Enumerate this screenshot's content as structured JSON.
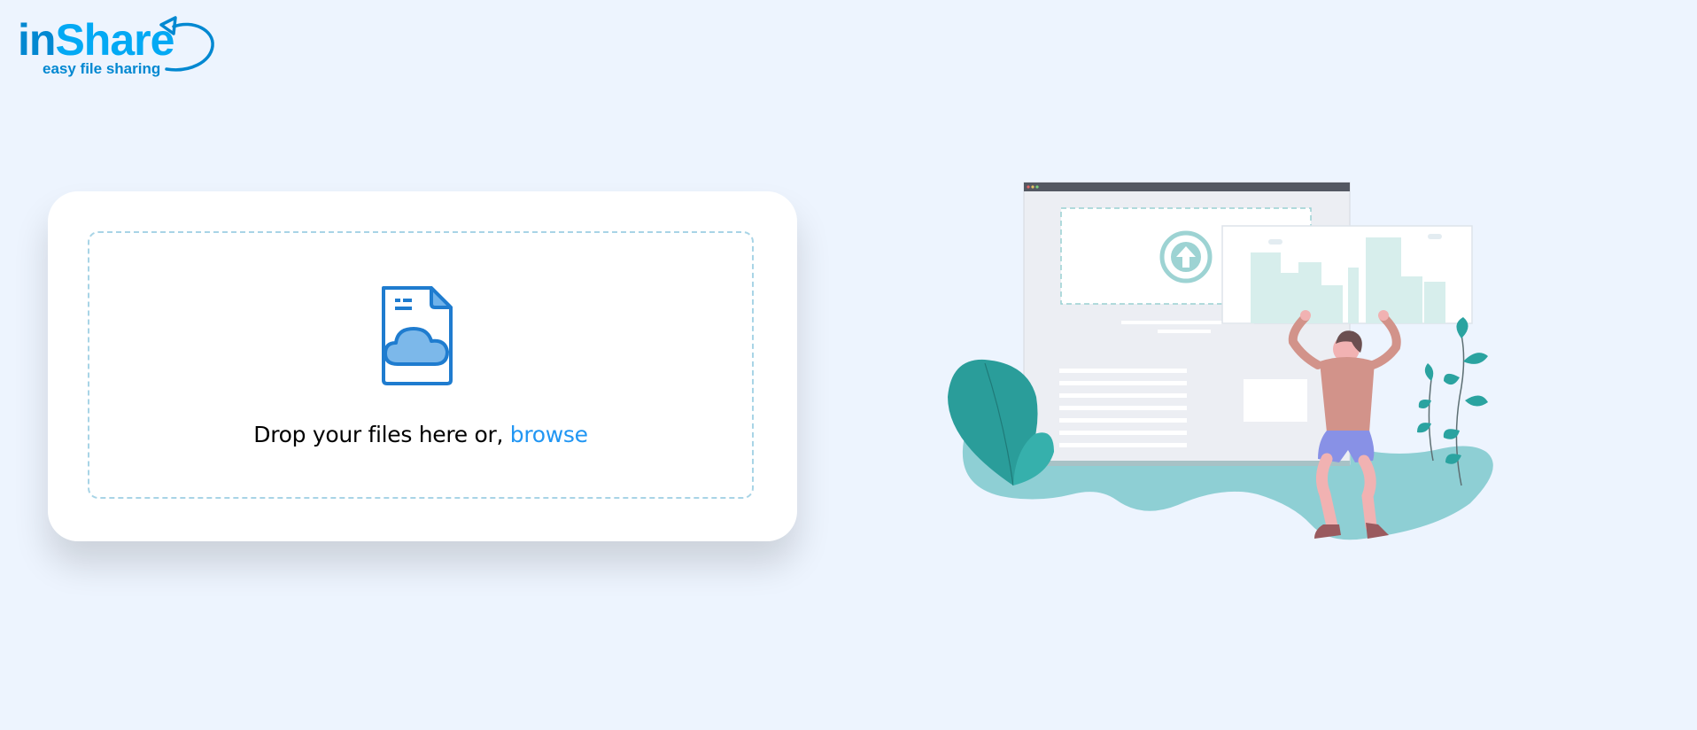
{
  "brand": {
    "name_part1": "in",
    "name_part2": "Share",
    "tagline": "easy file sharing"
  },
  "upload": {
    "prompt_text": "Drop your files here or, ",
    "browse_label": "browse"
  },
  "icons": {
    "file_icon": "cloud-file-icon",
    "upload_arrow": "upload-arrow-icon"
  },
  "colors": {
    "background": "#edf4fe",
    "brand": "#0288d1",
    "brand_accent": "#03a9f4",
    "link": "#2196f3",
    "dropzone_border": "#a8d4e6",
    "teal": "#2a9d9a"
  }
}
